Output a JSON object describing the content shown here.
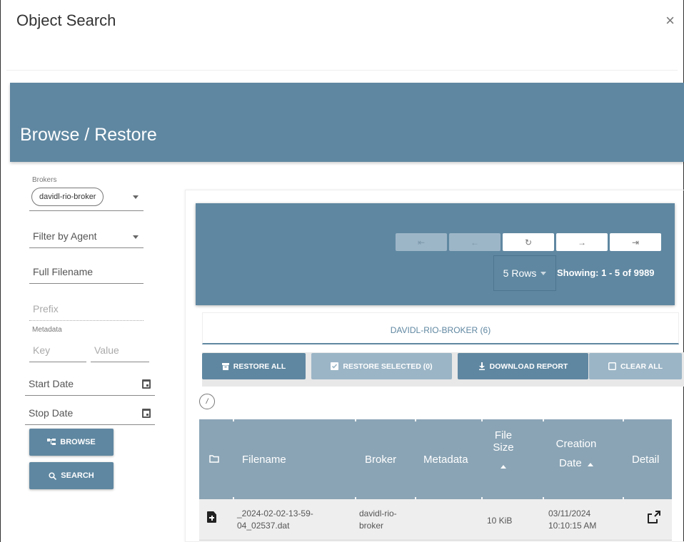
{
  "dialog": {
    "title": "Object Search",
    "close_label": "×"
  },
  "banner": {
    "title": "Browse / Restore"
  },
  "sidebar": {
    "brokers_label": "Brokers",
    "broker_selected": "davidl-rio-broker",
    "filter_agent_placeholder": "Filter by Agent",
    "full_filename_placeholder": "Full Filename",
    "prefix_placeholder": "Prefix",
    "metadata_label": "Metadata",
    "key_placeholder": "Key",
    "value_placeholder": "Value",
    "start_date_label": "Start Date",
    "stop_date_label": "Stop Date",
    "browse_button": "BROWSE",
    "search_button": "SEARCH"
  },
  "pager": {
    "first": "⇤",
    "prev": "←",
    "refresh": "↻",
    "next": "→",
    "last": "⇥",
    "rows_label": "5 Rows",
    "showing": "Showing: 1 - 5 of 9989"
  },
  "tabs": [
    {
      "label": "DAVIDL-RIO-BROKER (6)",
      "active": true
    }
  ],
  "actions": {
    "restore_all": "RESTORE ALL",
    "restore_selected": "RESTORE SELECTED (0)",
    "download_report": "DOWNLOAD REPORT",
    "clear_all": "CLEAR ALL"
  },
  "path": {
    "root": "/"
  },
  "table": {
    "columns": {
      "filename": "Filename",
      "broker": "Broker",
      "metadata": "Metadata",
      "file_size_1": "File",
      "file_size_2": "Size",
      "creation_1": "Creation",
      "creation_2": "Date",
      "detail": "Detail"
    },
    "rows": [
      {
        "filename_1": "_2024-02-02-13-59-",
        "filename_2": "04_02537.dat",
        "broker_1": "davidl-rio-",
        "broker_2": "broker",
        "metadata": "",
        "size": "10 KiB",
        "date_1": "03/11/2024",
        "date_2": "10:10:15 AM"
      }
    ]
  },
  "colors": {
    "accent": "#5f87a1",
    "accent_light": "#9bb5c6",
    "table_header": "#8aa4b5"
  }
}
